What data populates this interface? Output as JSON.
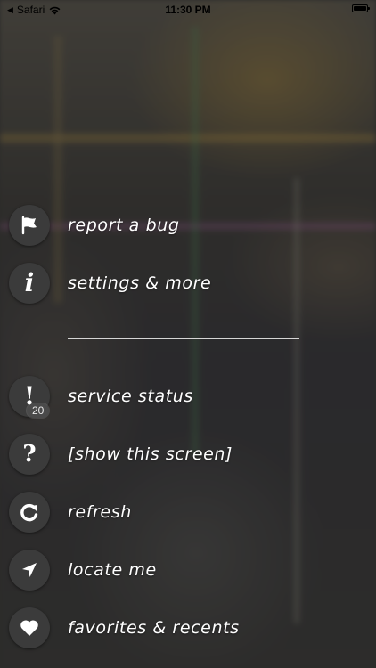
{
  "status_bar": {
    "back_app": "Safari",
    "time": "11:30 PM"
  },
  "menu": {
    "top_items": [
      {
        "label": "report a bug",
        "icon": "flag-icon"
      },
      {
        "label": "settings & more",
        "icon": "info-icon"
      }
    ],
    "bottom_items": [
      {
        "label": "service status",
        "icon": "exclamation-icon",
        "badge": "20"
      },
      {
        "label": "[show this screen]",
        "icon": "question-icon"
      },
      {
        "label": "refresh",
        "icon": "refresh-icon"
      },
      {
        "label": "locate me",
        "icon": "location-arrow-icon"
      },
      {
        "label": "favorites & recents",
        "icon": "heart-icon"
      }
    ]
  }
}
